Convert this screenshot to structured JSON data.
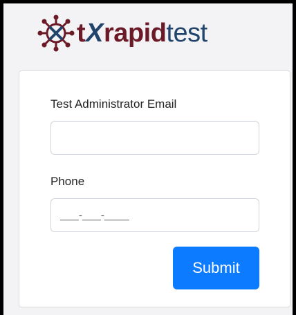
{
  "brand": {
    "logo_icon": "virus-icon",
    "name_t": "t",
    "name_x": "X",
    "name_rapid": "rapid",
    "name_test": "test",
    "colors": {
      "maroon": "#6b1a27",
      "navy": "#20446b"
    }
  },
  "form": {
    "email_label": "Test Administrator Email",
    "email_value": "",
    "email_placeholder": "",
    "phone_label": "Phone",
    "phone_value": "",
    "phone_placeholder": "___-___-____",
    "submit_label": "Submit",
    "submit_color": "#0d7bff"
  }
}
